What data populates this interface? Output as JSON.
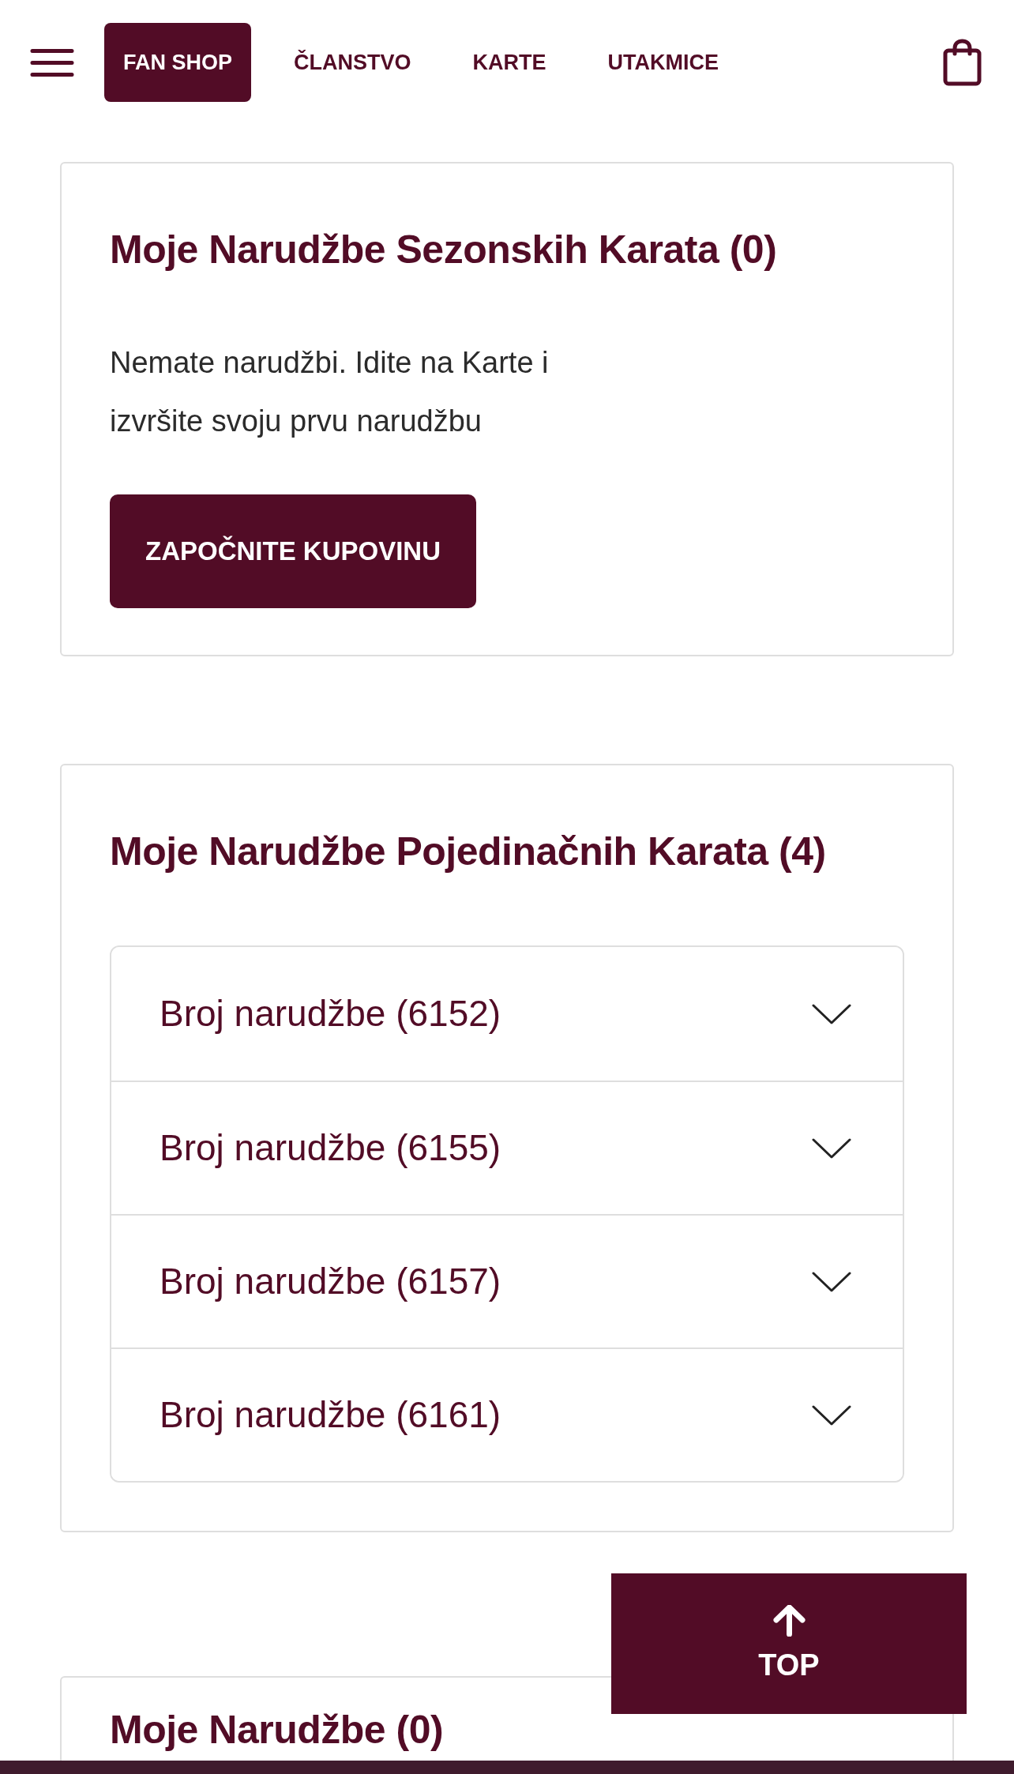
{
  "nav": {
    "items": [
      {
        "label": "FAN SHOP",
        "selected": true
      },
      {
        "label": "ČLANSTVO",
        "selected": false
      },
      {
        "label": "KARTE",
        "selected": false
      },
      {
        "label": "UTAKMICE",
        "selected": false
      }
    ]
  },
  "season_tickets": {
    "title": "Moje Narudžbe Sezonskih Karata (0)",
    "message": "Nemate narudžbi. Idite na Karte i izvršite svoju prvu narudžbu",
    "button": "ZAPOČNITE KUPOVINU"
  },
  "single_tickets": {
    "title": "Moje Narudžbe Pojedinačnih Karata (4)",
    "orders": [
      {
        "label": "Broj narudžbe (6152)",
        "expanded": false
      },
      {
        "label": "Broj narudžbe (6155)",
        "expanded": false
      },
      {
        "label": "Broj narudžbe (6157)",
        "expanded": false
      },
      {
        "label": "Broj narudžbe (6161)",
        "expanded": false
      }
    ]
  },
  "orders_panel": {
    "title": "Moje Narudžbe (0)"
  },
  "back_to_top": {
    "label": "TOP"
  }
}
